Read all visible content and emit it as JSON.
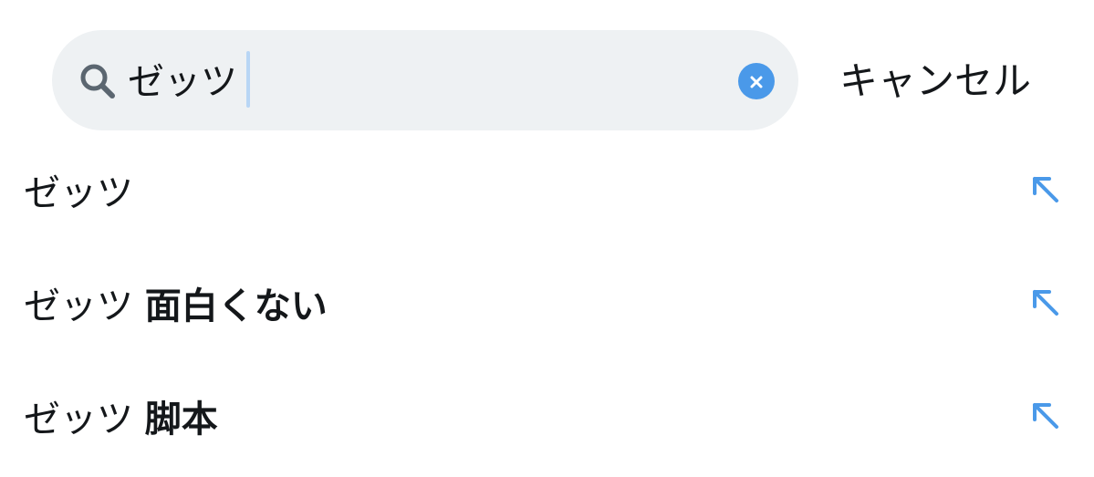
{
  "search": {
    "query": "ゼッツ",
    "cancel_label": "キャンセル",
    "search_icon": "search-icon",
    "clear_icon": "clear-icon"
  },
  "suggestions": [
    {
      "prefix": "ゼッツ",
      "suffix": ""
    },
    {
      "prefix": "ゼッツ",
      "suffix": "面白くない"
    },
    {
      "prefix": "ゼッツ",
      "suffix": "脚本"
    }
  ],
  "colors": {
    "accent": "#4a99e9",
    "search_bg": "#eef1f3",
    "text": "#14171a",
    "icon_gray": "#5b6670"
  },
  "suggestion_icon": "arrow-up-left-icon"
}
